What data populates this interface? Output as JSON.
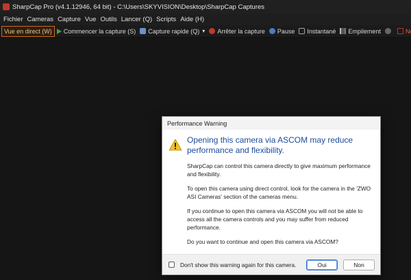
{
  "window": {
    "title": "SharpCap Pro (v4.1.12946, 64 bit) - C:\\Users\\SKYVISION\\Desktop\\SharpCap Captures"
  },
  "menu": {
    "items": [
      "Fichier",
      "Cameras",
      "Capture",
      "Vue",
      "Outils",
      "Lancer (Q)",
      "Scripts",
      "Aide (H)"
    ]
  },
  "toolbar": {
    "live_view": "Vue en direct (W)",
    "start_capture": "Commencer la capture (S)",
    "quick_capture": "Capture rapide (Q)",
    "quick_capture_dropdown": "▾",
    "stop_capture": "Arrêter la capture",
    "pause": "Pause",
    "snapshot": "Instantané",
    "stacking": "Empilement",
    "target_name": "Nom de la cible"
  },
  "dialog": {
    "title": "Performance Warning",
    "icon": "warning-icon",
    "headline": "Opening this camera via ASCOM may reduce performance and flexibility.",
    "paragraphs": [
      "SharpCap can control this camera directly to give maximum performance and flexibility.",
      "To open this camera using direct control, look for the camera in the 'ZWO ASI Cameras' section of the cameras menu.",
      "If you continue to open this camera via ASCOM you will not be able to access all the camera controls and you may suffer from reduced performance.",
      "Do you want to continue and open this camera via ASCOM?"
    ],
    "checkbox_label": "Don't show this warning again for this camera.",
    "checkbox_checked": false,
    "yes_label": "Oui",
    "no_label": "Non"
  },
  "colors": {
    "active_outline": "#d06a1e",
    "headline": "#1b4a9e",
    "stop": "#c0392b"
  }
}
